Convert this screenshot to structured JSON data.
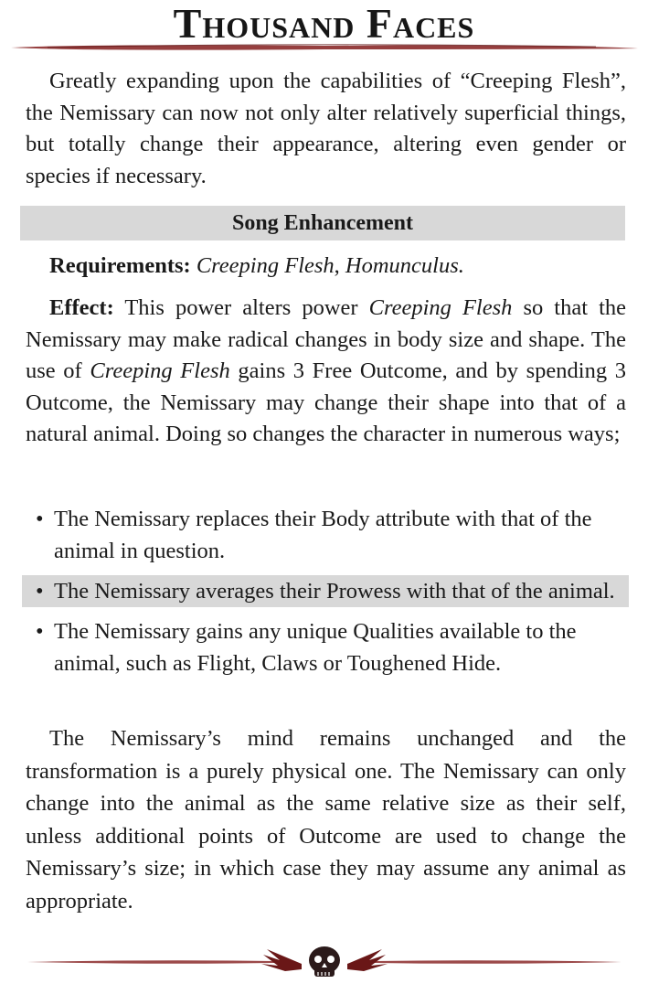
{
  "page": {
    "title": "Thousand Faces",
    "intro": "Greatly expanding upon the capabilities of “Creeping Flesh”, the Nemissary can now not only alter relatively superficial things, but totally change their appearance, altering even gender or species if necessary.",
    "section_heading": "Song Enhancement",
    "requirements": {
      "label": "Requirements:",
      "value_1": "Creeping Flesh",
      "separator": ", ",
      "value_2": "Homunculus."
    },
    "effect": {
      "label": "Effect:",
      "part_1": " This power alters power ",
      "power_1": "Creeping Flesh",
      "part_2": " so that the Nemissary may make radical changes in body size and shape. The use of ",
      "power_2": "Creeping Flesh",
      "part_3": " gains 3 Free Outcome, and by spending 3 Outcome, the Nemissary may change their shape into that of a natural animal. Doing so changes the character in numerous ways;"
    },
    "bullets": [
      "The Nemissary replaces their Body attribute with that of the animal in question.",
      "The Nemissary averages their Prowess with that of the animal.",
      "The Nemissary gains any unique Qualities available to the animal, such as Flight, Claws or Toughened Hide."
    ],
    "bullet_symbol": "•",
    "closing": "The Nemissary’s mind remains unchanged and the transformation is a purely physical one. The Nemissary can only change into the animal as the same relative size as their self, unless additional points of Outcome are used to change the Nemissary’s size; in which case they may assume any animal as appropriate.",
    "colors": {
      "rule": "#8b2a2a",
      "shade": "#d8d8d8",
      "text": "#1a1a1a"
    },
    "icons": {
      "footer": "winged-skull-icon"
    }
  }
}
